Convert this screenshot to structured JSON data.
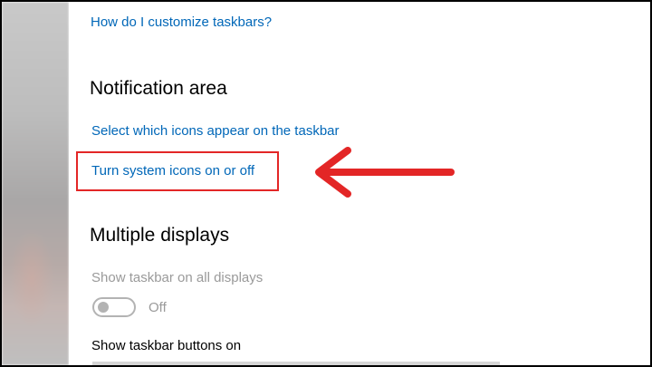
{
  "links": {
    "customize_taskbars": "How do I customize taskbars?",
    "select_icons": "Select which icons appear on the taskbar",
    "system_icons": "Turn system icons on or off"
  },
  "sections": {
    "notification_area": "Notification area",
    "multiple_displays": "Multiple displays"
  },
  "settings": {
    "show_taskbar_all_displays": {
      "label": "Show taskbar on all displays",
      "state": "Off",
      "enabled": false
    },
    "show_taskbar_buttons_on": {
      "label": "Show taskbar buttons on"
    }
  },
  "colors": {
    "link": "#0067b8",
    "annotation_red": "#e32626",
    "disabled_gray": "#9a9a9a"
  },
  "icons": {
    "annotation_arrow": "left-arrow-icon"
  }
}
